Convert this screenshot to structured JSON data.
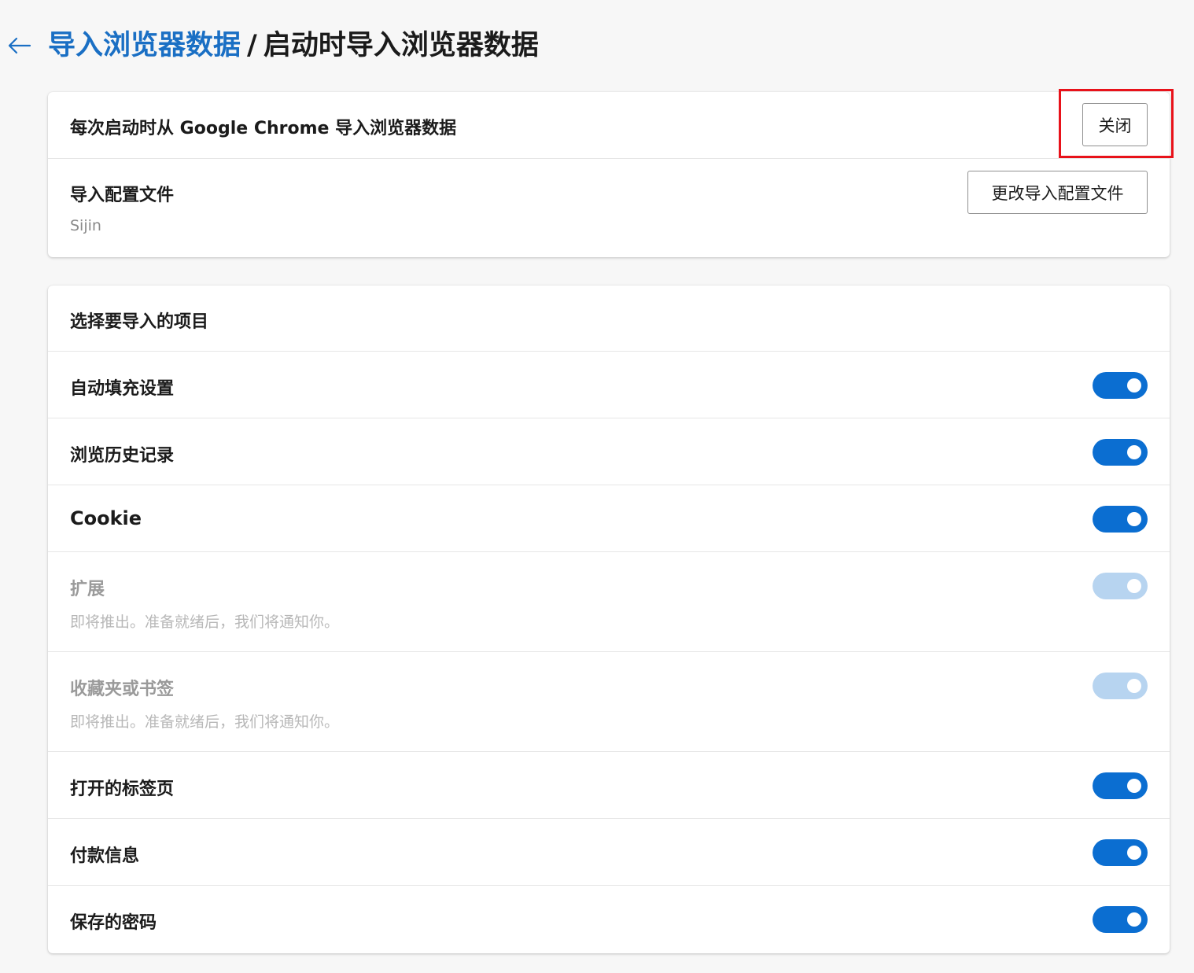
{
  "header": {
    "breadcrumb_link": "导入浏览器数据",
    "separator": "/",
    "breadcrumb_current": "启动时导入浏览器数据"
  },
  "import_settings": {
    "startup_import_label": "每次启动时从 Google Chrome 导入浏览器数据",
    "close_button": "关闭",
    "profile_label": "导入配置文件",
    "profile_value": "Sijin",
    "change_profile_button": "更改导入配置文件"
  },
  "items_section": {
    "title": "选择要导入的项目",
    "items": [
      {
        "label": "自动填充设置",
        "enabled": true,
        "disabled": false,
        "sublabel": ""
      },
      {
        "label": "浏览历史记录",
        "enabled": true,
        "disabled": false,
        "sublabel": ""
      },
      {
        "label": "Cookie",
        "enabled": true,
        "disabled": false,
        "sublabel": ""
      },
      {
        "label": "扩展",
        "enabled": true,
        "disabled": true,
        "sublabel": "即将推出。准备就绪后，我们将通知你。"
      },
      {
        "label": "收藏夹或书签",
        "enabled": true,
        "disabled": true,
        "sublabel": "即将推出。准备就绪后，我们将通知你。"
      },
      {
        "label": "打开的标签页",
        "enabled": true,
        "disabled": false,
        "sublabel": ""
      },
      {
        "label": "付款信息",
        "enabled": true,
        "disabled": false,
        "sublabel": ""
      },
      {
        "label": "保存的密码",
        "enabled": true,
        "disabled": false,
        "sublabel": ""
      }
    ]
  },
  "colors": {
    "accent": "#0b6ed1",
    "link": "#1a6fc4",
    "toggle_disabled": "#b7d4f0",
    "highlight_box": "#e8121a"
  },
  "icons": {
    "back": "arrow-left-icon"
  }
}
